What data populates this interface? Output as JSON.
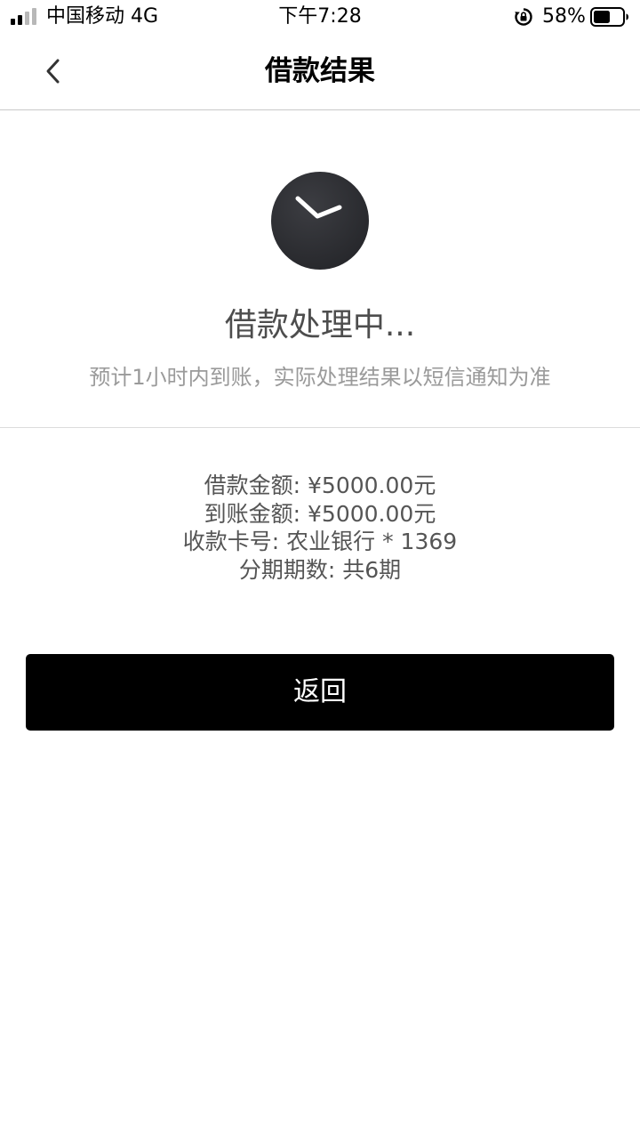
{
  "status_bar": {
    "carrier": "中国移动 4G",
    "time": "下午7:28",
    "battery_percent": "58%",
    "battery_level": 0.58,
    "signal_bars_active": 2,
    "signal_bars_total": 4,
    "icons": [
      "signal-icon",
      "rotation-lock-icon",
      "battery-icon"
    ]
  },
  "nav": {
    "title": "借款结果",
    "back_icon": "chevron-left-icon"
  },
  "result": {
    "icon": "clock-icon",
    "title": "借款处理中...",
    "subtitle": "预计1小时内到账，实际处理结果以短信通知为准"
  },
  "details": {
    "loan_amount": "借款金额: ¥5000.00元",
    "received_amount": "到账金额: ¥5000.00元",
    "card_number": "收款卡号: 农业银行 * 1369",
    "installments": "分期期数: 共6期"
  },
  "actions": {
    "return_label": "返回"
  },
  "colors": {
    "button_bg": "#000000",
    "button_text": "#ffffff",
    "icon_circle": "#2f3034",
    "title_text": "#4d4d4d",
    "subtitle_text": "#9a9a9a",
    "detail_text": "#555555"
  }
}
